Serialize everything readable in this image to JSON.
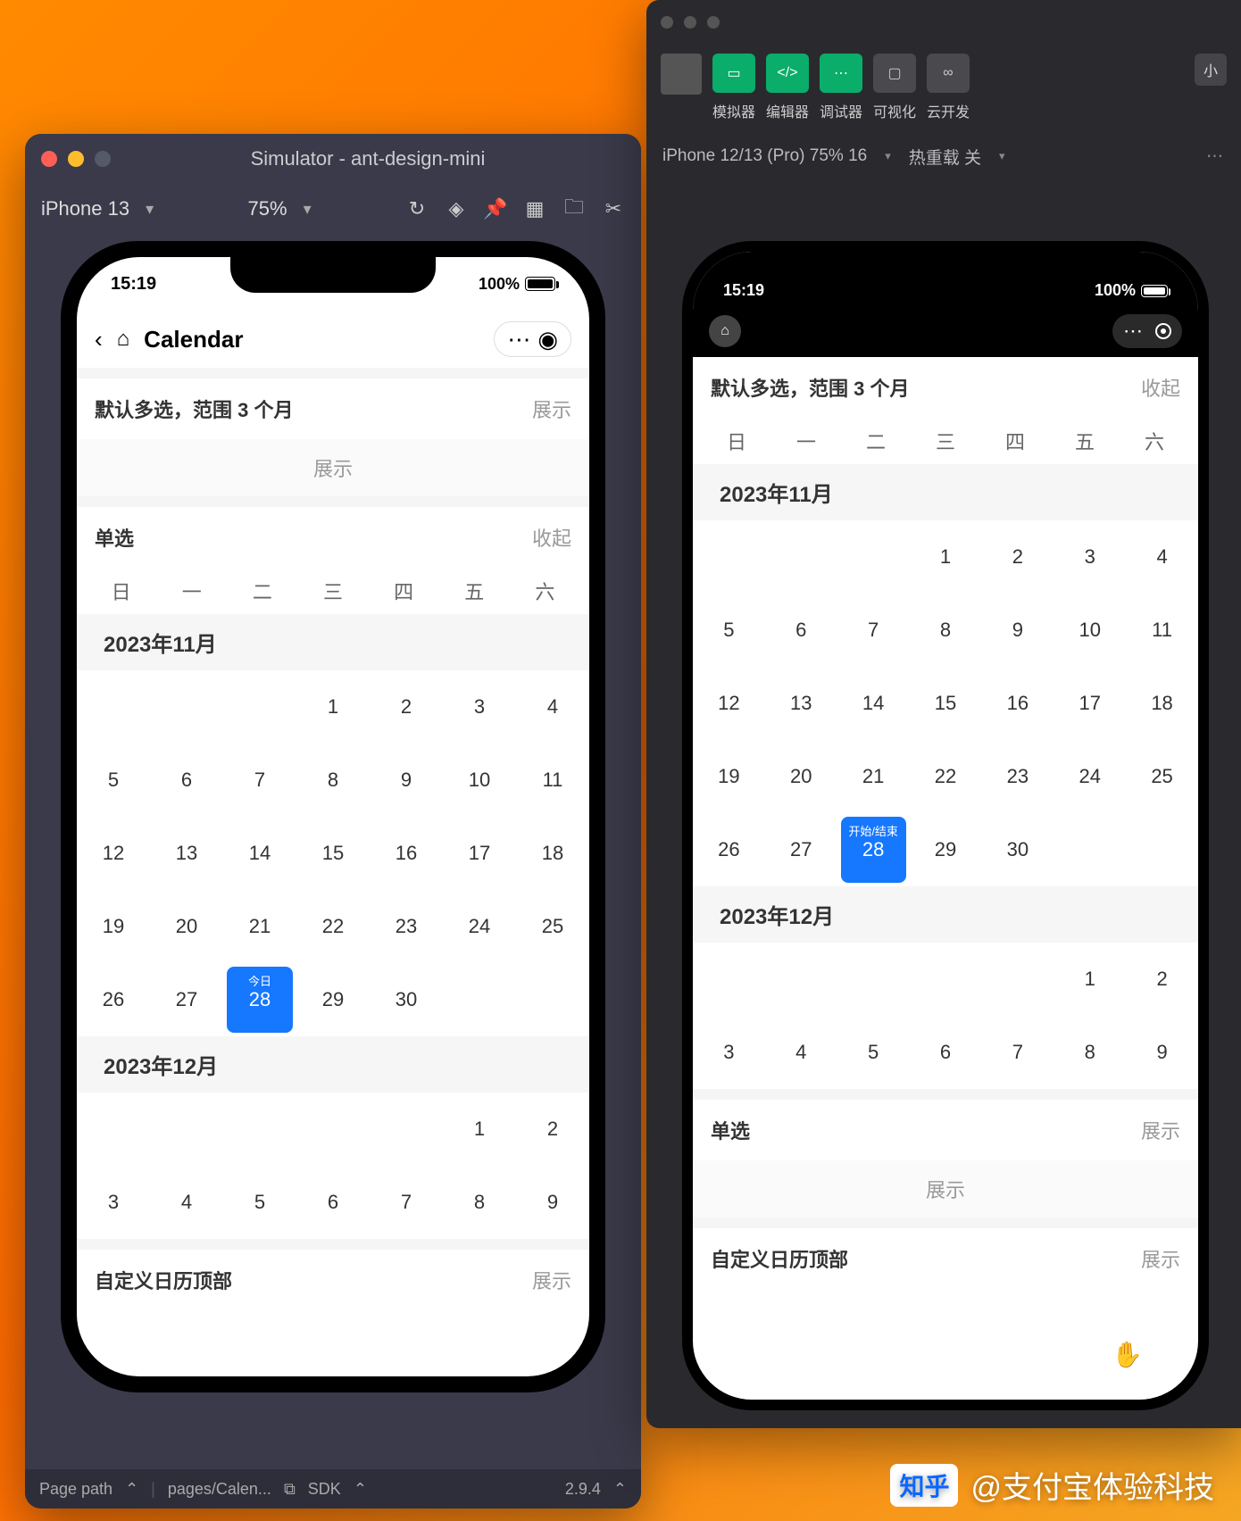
{
  "left": {
    "title": "Simulator - ant-design-mini",
    "device": "iPhone 13",
    "zoom": "75%",
    "statusbar": {
      "page_path": "Page path",
      "page": "pages/Calen...",
      "sdk": "SDK",
      "ver": "2.9.4"
    },
    "phone": {
      "time": "15:19",
      "battery": "100%",
      "page_title": "Calendar",
      "section1": {
        "title": "默认多选，范围 3 个月",
        "action": "展示",
        "expand": "展示"
      },
      "section2": {
        "title": "单选",
        "action": "收起",
        "weekdays": [
          "日",
          "一",
          "二",
          "三",
          "四",
          "五",
          "六"
        ],
        "month1": "2023年11月",
        "nov_rows": [
          [
            "",
            "",
            "",
            "1",
            "2",
            "3",
            "4"
          ],
          [
            "5",
            "6",
            "7",
            "8",
            "9",
            "10",
            "11"
          ],
          [
            "12",
            "13",
            "14",
            "15",
            "16",
            "17",
            "18"
          ],
          [
            "19",
            "20",
            "21",
            "22",
            "23",
            "24",
            "25"
          ],
          [
            "26",
            "27",
            "28",
            "29",
            "30",
            "",
            ""
          ]
        ],
        "today_tag": "今日",
        "month2": "2023年12月",
        "dec_rows": [
          [
            "",
            "",
            "",
            "",
            "",
            "1",
            "2"
          ],
          [
            "3",
            "4",
            "5",
            "6",
            "7",
            "8",
            "9"
          ]
        ]
      },
      "section3": {
        "title": "自定义日历顶部",
        "action": "展示"
      }
    }
  },
  "right": {
    "toolbar": {
      "btns": [
        {
          "label": "模拟器",
          "color": "green",
          "icon": "▭"
        },
        {
          "label": "编辑器",
          "color": "green",
          "icon": "</>"
        },
        {
          "label": "调试器",
          "color": "green",
          "icon": "⋯"
        },
        {
          "label": "可视化",
          "color": "gray",
          "icon": "▢"
        },
        {
          "label": "云开发",
          "color": "gray",
          "icon": "∞"
        }
      ],
      "pill": "小"
    },
    "subbar": {
      "device": "iPhone 12/13 (Pro) 75% 16",
      "reload": "热重载 关"
    },
    "phone": {
      "time": "15:19",
      "battery": "100%",
      "section1": {
        "title": "默认多选，范围 3 个月",
        "action": "收起",
        "weekdays": [
          "日",
          "一",
          "二",
          "三",
          "四",
          "五",
          "六"
        ],
        "month1": "2023年11月",
        "nov_rows": [
          [
            "",
            "",
            "",
            "1",
            "2",
            "3",
            "4"
          ],
          [
            "5",
            "6",
            "7",
            "8",
            "9",
            "10",
            "11"
          ],
          [
            "12",
            "13",
            "14",
            "15",
            "16",
            "17",
            "18"
          ],
          [
            "19",
            "20",
            "21",
            "22",
            "23",
            "24",
            "25"
          ],
          [
            "26",
            "27",
            "28",
            "29",
            "30",
            "",
            ""
          ]
        ],
        "sel_tag": "开始/结束",
        "month2": "2023年12月",
        "dec_rows": [
          [
            "",
            "",
            "",
            "",
            "",
            "1",
            "2"
          ],
          [
            "3",
            "4",
            "5",
            "6",
            "7",
            "8",
            "9"
          ]
        ]
      },
      "section2": {
        "title": "单选",
        "action": "展示",
        "expand": "展示"
      },
      "section3": {
        "title": "自定义日历顶部",
        "action": "展示"
      }
    }
  },
  "watermark": {
    "logo": "知乎",
    "text": "@支付宝体验科技"
  }
}
